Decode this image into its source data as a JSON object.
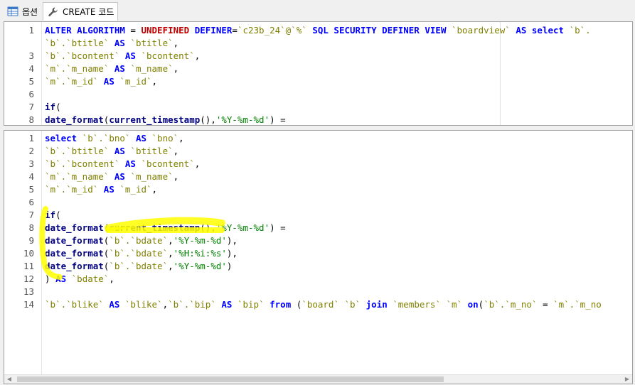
{
  "tabs": [
    {
      "label": "옵션",
      "icon": "table-grid-icon",
      "active": false
    },
    {
      "label": "CREATE 코드",
      "icon": "wrench-icon",
      "active": true
    }
  ],
  "pane_top": {
    "lines": [
      {
        "n": "1",
        "tokens": [
          [
            "kw",
            "ALTER ALGORITHM"
          ],
          [
            "pl",
            " = "
          ],
          [
            "kw2",
            "UNDEFINED"
          ],
          [
            "kw",
            " DEFINER"
          ],
          [
            "pl",
            "="
          ],
          [
            "id",
            "`c23b_24`@`%`"
          ],
          [
            "kw",
            " SQL SECURITY DEFINER VIEW "
          ],
          [
            "id",
            "`boardview`"
          ],
          [
            "kw",
            " AS select "
          ],
          [
            "id",
            "`b`."
          ]
        ]
      },
      {
        "n": "",
        "tokens": [
          [
            "id",
            "`b`.`btitle`"
          ],
          [
            "kw",
            " AS "
          ],
          [
            "id",
            "`btitle`"
          ],
          [
            "pl",
            ","
          ]
        ]
      },
      {
        "n": "3",
        "tokens": [
          [
            "id",
            "`b`.`bcontent`"
          ],
          [
            "kw",
            " AS "
          ],
          [
            "id",
            "`bcontent`"
          ],
          [
            "pl",
            ","
          ]
        ]
      },
      {
        "n": "4",
        "tokens": [
          [
            "id",
            "`m`.`m_name`"
          ],
          [
            "kw",
            " AS "
          ],
          [
            "id",
            "`m_name`"
          ],
          [
            "pl",
            ","
          ]
        ]
      },
      {
        "n": "5",
        "tokens": [
          [
            "id",
            "`m`.`m_id`"
          ],
          [
            "kw",
            " AS "
          ],
          [
            "id",
            "`m_id`"
          ],
          [
            "pl",
            ","
          ]
        ]
      },
      {
        "n": "6",
        "tokens": []
      },
      {
        "n": "7",
        "tokens": [
          [
            "fn",
            "if"
          ],
          [
            "pl",
            "("
          ]
        ]
      },
      {
        "n": "8",
        "tokens": [
          [
            "fn",
            "date_format"
          ],
          [
            "pl",
            "("
          ],
          [
            "fn",
            "current_timestamp"
          ],
          [
            "pl",
            "(),"
          ],
          [
            "st",
            "'%Y-%m-%d'"
          ],
          [
            "pl",
            ") ="
          ]
        ]
      }
    ]
  },
  "pane_bottom": {
    "lines": [
      {
        "n": "1",
        "tokens": [
          [
            "kw",
            "select "
          ],
          [
            "id",
            "`b`.`bno`"
          ],
          [
            "kw",
            " AS "
          ],
          [
            "id",
            "`bno`"
          ],
          [
            "pl",
            ","
          ]
        ]
      },
      {
        "n": "2",
        "tokens": [
          [
            "id",
            "`b`.`btitle`"
          ],
          [
            "kw",
            " AS "
          ],
          [
            "id",
            "`btitle`"
          ],
          [
            "pl",
            ","
          ]
        ]
      },
      {
        "n": "3",
        "tokens": [
          [
            "id",
            "`b`.`bcontent`"
          ],
          [
            "kw",
            " AS "
          ],
          [
            "id",
            "`bcontent`"
          ],
          [
            "pl",
            ","
          ]
        ]
      },
      {
        "n": "4",
        "tokens": [
          [
            "id",
            "`m`.`m_name`"
          ],
          [
            "kw",
            " AS "
          ],
          [
            "id",
            "`m_name`"
          ],
          [
            "pl",
            ","
          ]
        ]
      },
      {
        "n": "5",
        "tokens": [
          [
            "id",
            "`m`.`m_id`"
          ],
          [
            "kw",
            " AS "
          ],
          [
            "id",
            "`m_id`"
          ],
          [
            "pl",
            ","
          ]
        ]
      },
      {
        "n": "6",
        "tokens": []
      },
      {
        "n": "7",
        "tokens": [
          [
            "fn",
            "if"
          ],
          [
            "pl",
            "("
          ]
        ]
      },
      {
        "n": "8",
        "tokens": [
          [
            "fn",
            "date_format"
          ],
          [
            "pl",
            "("
          ],
          [
            "fn",
            "current_timestamp"
          ],
          [
            "pl",
            "(),"
          ],
          [
            "st",
            "'%Y-%m-%d'"
          ],
          [
            "pl",
            ") ="
          ]
        ]
      },
      {
        "n": "9",
        "tokens": [
          [
            "fn",
            "date_format"
          ],
          [
            "pl",
            "("
          ],
          [
            "id",
            "`b`.`bdate`"
          ],
          [
            "pl",
            ","
          ],
          [
            "st",
            "'%Y-%m-%d'"
          ],
          [
            "pl",
            "),"
          ]
        ]
      },
      {
        "n": "10",
        "tokens": [
          [
            "fn",
            "date_format"
          ],
          [
            "pl",
            "("
          ],
          [
            "id",
            "`b`.`bdate`"
          ],
          [
            "pl",
            ","
          ],
          [
            "st",
            "'%H:%i:%s'"
          ],
          [
            "pl",
            "),"
          ]
        ]
      },
      {
        "n": "11",
        "tokens": [
          [
            "fn",
            "date_format"
          ],
          [
            "pl",
            "("
          ],
          [
            "id",
            "`b`.`bdate`"
          ],
          [
            "pl",
            ","
          ],
          [
            "st",
            "'%Y-%m-%d'"
          ],
          [
            "pl",
            ")"
          ]
        ]
      },
      {
        "n": "12",
        "tokens": [
          [
            "pl",
            ") "
          ],
          [
            "kw",
            "AS "
          ],
          [
            "id",
            "`bdate`"
          ],
          [
            "pl",
            ","
          ]
        ]
      },
      {
        "n": "13",
        "tokens": []
      },
      {
        "n": "14",
        "tokens": [
          [
            "id",
            "`b`.`blike`"
          ],
          [
            "kw",
            " AS "
          ],
          [
            "id",
            "`blike`"
          ],
          [
            "pl",
            ","
          ],
          [
            "id",
            "`b`.`bip`"
          ],
          [
            "kw",
            " AS "
          ],
          [
            "id",
            "`bip`"
          ],
          [
            "kw",
            " from "
          ],
          [
            "pl",
            "("
          ],
          [
            "id",
            "`board` `b`"
          ],
          [
            "kw",
            " join "
          ],
          [
            "id",
            "`members` `m`"
          ],
          [
            "kw",
            " on"
          ],
          [
            "pl",
            "("
          ],
          [
            "id",
            "`b`.`m_no`"
          ],
          [
            "pl",
            " = "
          ],
          [
            "id",
            "`m`.`m_no"
          ]
        ]
      }
    ]
  },
  "colors": {
    "keyword": "#0000ff",
    "keyword_red": "#c00000",
    "function": "#000080",
    "identifier": "#808000",
    "string": "#008000",
    "highlight": "#ffff00"
  }
}
